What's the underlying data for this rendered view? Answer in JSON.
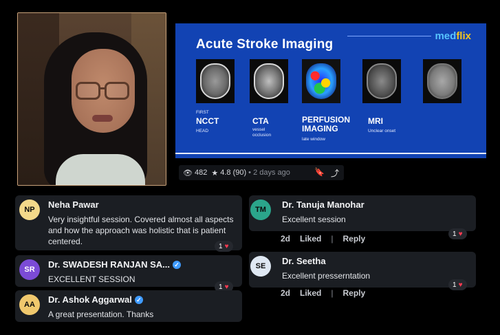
{
  "slide": {
    "title": "Acute Stroke Imaging",
    "brand_part1": "med",
    "brand_part2": "flix",
    "columns": [
      {
        "pre": "FIRST",
        "label": "NCCT",
        "sub": "HEAD"
      },
      {
        "pre": "",
        "label": "CTA",
        "sub": "vessel occlusion"
      },
      {
        "pre": "",
        "label": "PERFUSION IMAGING",
        "sub": "late window"
      },
      {
        "pre": "",
        "label": "MRI",
        "sub": "Unclear onset"
      }
    ]
  },
  "stats": {
    "views": "482",
    "rating": "4.8",
    "ratings_count": "(90)",
    "posted": "2 days ago"
  },
  "comments": [
    {
      "initials": "NP",
      "name": "Neha Pawar",
      "text": "Very insightful session. Covered almost all aspects and how the approach was holistic that is patient centered.",
      "likes": "1"
    },
    {
      "initials": "SR",
      "name": "Dr. SWADESH RANJAN SA...",
      "text": "EXCELLENT SESSION",
      "likes": "1"
    },
    {
      "initials": "AA",
      "name": "Dr. Ashok Aggarwal",
      "text": "A great presentation. Thanks"
    },
    {
      "initials": "TM",
      "name": "Dr. Tanuja Manohar",
      "text": "Excellent session",
      "likes": "1",
      "time": "2d",
      "liked": "Liked",
      "reply": "Reply"
    },
    {
      "initials": "SE",
      "name": "Dr. Seetha",
      "text": "Excellent presserntation",
      "likes": "1",
      "time": "2d",
      "liked": "Liked",
      "reply": "Reply"
    }
  ],
  "colors": {
    "slide_bg": "#1243b3",
    "avatar_np": "#f3d98a",
    "avatar_sr": "#7b4bd6",
    "avatar_aa": "#f0c86d",
    "avatar_tm": "#2ba58b",
    "avatar_se": "#dfe8f3",
    "heart": "#ff3b52",
    "verified": "#3f9bff"
  },
  "icons": {
    "views": "eye-icon",
    "rating": "star-icon",
    "bookmark": "bookmark-icon",
    "share": "share-icon",
    "verified": "verified-badge-icon",
    "like": "heart-icon"
  }
}
